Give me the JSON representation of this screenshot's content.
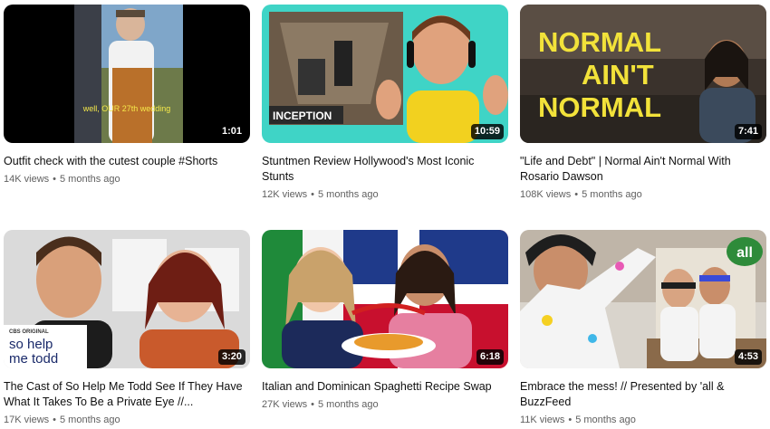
{
  "videos": [
    {
      "title": "Outfit check with the cutest couple #Shorts",
      "duration": "1:01",
      "views": "14K views",
      "age": "5 months ago",
      "thumb_caption": "well, OUR 27th wedding"
    },
    {
      "title": "Stuntmen Review Hollywood's Most Iconic Stunts",
      "duration": "10:59",
      "views": "12K views",
      "age": "5 months ago",
      "thumb_caption": "INCEPTION"
    },
    {
      "title": "\"Life and Debt\" | Normal Ain't Normal With Rosario Dawson",
      "duration": "7:41",
      "views": "108K views",
      "age": "5 months ago",
      "thumb_line1": "NORMAL",
      "thumb_line2": "AIN'T",
      "thumb_line3": "NORMAL"
    },
    {
      "title": "The Cast of So Help Me Todd See If They Have What It Takes To Be a Private Eye //...",
      "duration": "3:20",
      "views": "17K views",
      "age": "5 months ago",
      "thumb_network": "CBS ORIGINAL",
      "thumb_show_line1": "so help",
      "thumb_show_line2": "me todd"
    },
    {
      "title": "Italian and Dominican Spaghetti Recipe Swap",
      "duration": "6:18",
      "views": "27K views",
      "age": "5 months ago"
    },
    {
      "title": "Embrace the mess! // Presented by 'all & BuzzFeed",
      "duration": "4:53",
      "views": "11K views",
      "age": "5 months ago",
      "thumb_brand": "all"
    }
  ],
  "colors": {
    "meta_text": "#606060",
    "title_text": "#0f0f0f",
    "duration_bg": "#000000"
  }
}
